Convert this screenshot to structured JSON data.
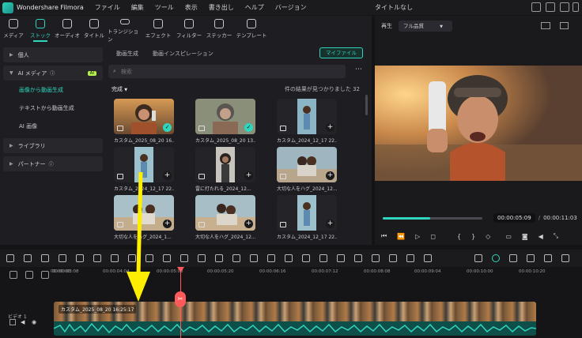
{
  "menubar": {
    "app_name": "Wondershare Filmora",
    "items": [
      "ファイル",
      "編集",
      "ツール",
      "表示",
      "書き出し",
      "ヘルプ",
      "バージョン"
    ],
    "project_title": "タイトルなし"
  },
  "toptools": [
    {
      "label": "メディア",
      "icon": "media-icon"
    },
    {
      "label": "ストック",
      "icon": "stock-icon"
    },
    {
      "label": "オーディオ",
      "icon": "music-note-icon"
    },
    {
      "label": "タイトル",
      "icon": "title-icon"
    },
    {
      "label": "トランジション",
      "icon": "transition-icon"
    },
    {
      "label": "エフェクト",
      "icon": "effect-icon"
    },
    {
      "label": "フィルター",
      "icon": "filter-icon"
    },
    {
      "label": "ステッカー",
      "icon": "sticker-icon"
    },
    {
      "label": "テンプレート",
      "icon": "template-icon"
    }
  ],
  "sidebar": {
    "personal": "個人",
    "ai_media": "AI メディア",
    "ai_badge": "AI",
    "items": [
      "画像から動画生成",
      "テキストから動画生成",
      "AI 画像"
    ],
    "library": "ライブラリ",
    "partner": "パートナー"
  },
  "content": {
    "tabs": [
      "動画生成",
      "動画インスピレーション"
    ],
    "my_file": "マイファイル",
    "search_placeholder": "検索",
    "filter": "完成",
    "result_count": "件の結果が見つかりました 32",
    "cards": [
      {
        "label": "カスタム_2025_08_20 16...",
        "status": "selected"
      },
      {
        "label": "カスタム_2025_08_20 13...",
        "status": "selected"
      },
      {
        "label": "カスタム_2024_12_17 22...",
        "status": "add"
      },
      {
        "label": "カスタム_2024_12_17 22...",
        "status": "add"
      },
      {
        "label": "雷に打たれる_2024_12...",
        "status": "add"
      },
      {
        "label": "大切な人をハグ_2024_12...",
        "status": "add"
      },
      {
        "label": "大切な人をハグ_2024_1...",
        "status": "add"
      },
      {
        "label": "大切な人をハグ_2024_12...",
        "status": "add"
      },
      {
        "label": "カスタム_2024_12_17 22...",
        "status": "add"
      }
    ]
  },
  "player": {
    "label": "再生",
    "quality": "フル品質",
    "current_time": "00:00:05:09",
    "total_time": "00:00:11:03",
    "progress": 0.48
  },
  "timeline": {
    "ruler": [
      "00:00:00",
      "00:00:03:08",
      "00:00:04:04",
      "00:00:05:00",
      "00:00:05:20",
      "00:00:06:16",
      "00:00:07:12",
      "00:00:08:08",
      "00:00:09:04",
      "00:00:10:00",
      "00:00:10:20"
    ],
    "clip_name": "カスタム_2025_08_20 16:25:17",
    "track_label": "ビデオ 1"
  },
  "colors": {
    "accent": "#2fd6bd",
    "playhead": "#ff5a5a",
    "arrow": "#ffee00"
  }
}
